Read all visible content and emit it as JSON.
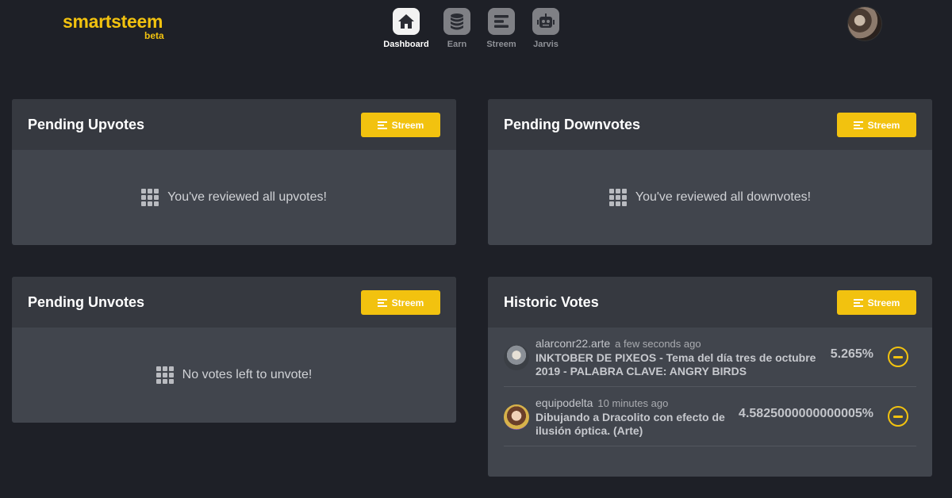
{
  "header": {
    "logo_name": "smartsteem",
    "logo_tag": "beta",
    "nav": [
      {
        "label": "Dashboard",
        "icon": "home-icon",
        "active": true
      },
      {
        "label": "Earn",
        "icon": "coins-icon",
        "active": false
      },
      {
        "label": "Streem",
        "icon": "stream-icon",
        "active": false
      },
      {
        "label": "Jarvis",
        "icon": "robot-icon",
        "active": false
      }
    ]
  },
  "stream_label": "Streem",
  "cards": {
    "upvotes": {
      "title": "Pending Upvotes",
      "empty": "You've reviewed all upvotes!"
    },
    "downvotes": {
      "title": "Pending Downvotes",
      "empty": "You've reviewed all downvotes!"
    },
    "unvotes": {
      "title": "Pending Unvotes",
      "empty": "No votes left to unvote!"
    },
    "historic": {
      "title": "Historic Votes",
      "votes": [
        {
          "author": "alarconr22.arte",
          "time": "a few seconds ago",
          "title": "INKTOBER DE PIXEOS - Tema del día tres de octubre 2019 - PALABRA CLAVE: ANGRY BIRDS",
          "percent": "5.265%"
        },
        {
          "author": "equipodelta",
          "time": "10 minutes ago",
          "title": "Dibujando a Dracolito con efecto de ilusión óptica. (Arte)",
          "percent": "4.5825000000000005%"
        }
      ]
    }
  },
  "colors": {
    "accent": "#f2c20f",
    "background": "#1e2027",
    "card_body": "#41454d",
    "card_head": "#363940"
  }
}
